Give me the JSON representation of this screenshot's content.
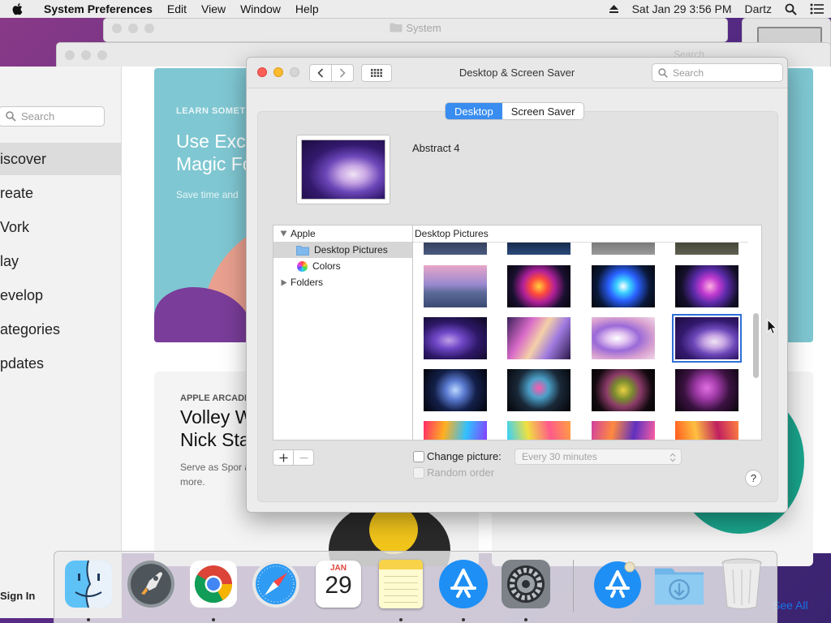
{
  "menubar": {
    "app_name": "System Preferences",
    "items": [
      "Edit",
      "View",
      "Window",
      "Help"
    ],
    "datetime": "Sat Jan 29  3:56 PM",
    "user": "Dartz"
  },
  "background_window": {
    "title": "System",
    "search_placeholder": "Search"
  },
  "store": {
    "search_placeholder": "Search",
    "nav": [
      "iscover",
      "reate",
      "Vork",
      "lay",
      "evelop",
      "ategories",
      "pdates"
    ],
    "hero_kicker": "LEARN SOMETH",
    "hero_title": "Use Exc Magic Fo",
    "hero_sub": "Save time and",
    "card_kicker": "APPLE ARCADE",
    "card_title": "Volley W Nick Sta",
    "card_sub": "Serve as Spor and more.",
    "sign_in": "Sign In",
    "see_all": "See All"
  },
  "prefs": {
    "title": "Desktop & Screen Saver",
    "search_placeholder": "Search",
    "tabs": [
      "Desktop",
      "Screen Saver"
    ],
    "selected_wallpaper": "Abstract 4",
    "source_list": {
      "group": "Apple",
      "items": [
        "Desktop Pictures",
        "Colors"
      ],
      "folders": "Folders"
    },
    "grid_header": "Desktop Pictures",
    "change_picture_label": "Change picture:",
    "interval": "Every 30 minutes",
    "random_order_label": "Random order",
    "help": "?"
  },
  "dock": {
    "icons": [
      "finder-icon",
      "launchpad-icon",
      "chrome-icon",
      "safari-icon",
      "calendar-icon",
      "notes-icon",
      "app-store-icon",
      "system-preferences-icon",
      "app-store-downloads-icon",
      "downloads-folder-icon",
      "trash-icon"
    ],
    "calendar_month": "JAN",
    "calendar_day": "29"
  },
  "colors": {
    "accent": "#3a8df0",
    "selection": "#2f6fd6"
  }
}
